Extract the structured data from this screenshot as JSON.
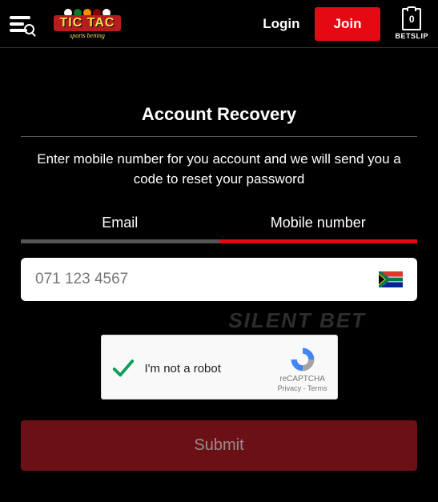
{
  "header": {
    "login_label": "Login",
    "join_label": "Join",
    "betslip_count": "0",
    "betslip_label": "BETSLIP",
    "logo_text": "TIC TAC",
    "logo_sub": "sports betting"
  },
  "page": {
    "title": "Account Recovery",
    "instruction": "Enter mobile number for you account and we will send you a code to reset your password"
  },
  "tabs": {
    "email": "Email",
    "mobile": "Mobile number",
    "active": "mobile"
  },
  "input": {
    "placeholder": "071 123 4567",
    "country": "ZA"
  },
  "captcha": {
    "label": "I'm not a robot",
    "brand": "reCAPTCHA",
    "terms": "Privacy - Terms",
    "checked": true
  },
  "submit_label": "Submit",
  "watermark": "SILENT   BET"
}
